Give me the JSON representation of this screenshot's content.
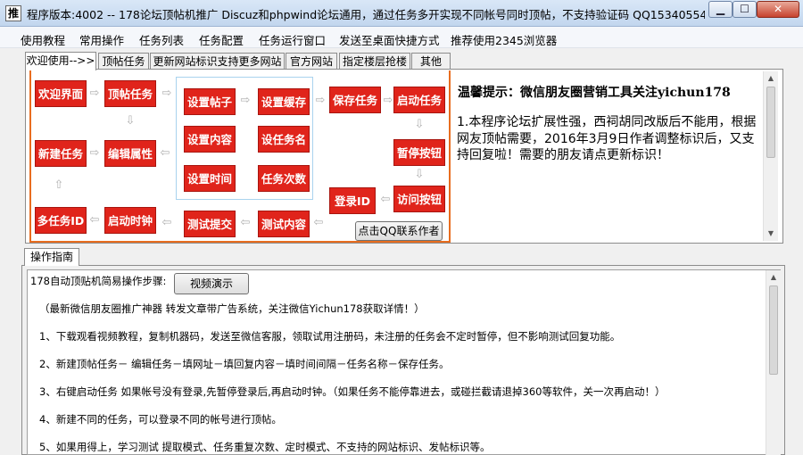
{
  "window": {
    "title": "程序版本:4002 -- 178论坛顶帖机推广 Discuz和phpwind论坛通用，通过任务多开实现不同帐号同时顶帖，不支持验证码   QQ15340554 官网...",
    "app_icon": "推",
    "min_glyph": "▁",
    "max_glyph": "☐",
    "close_glyph": "✕"
  },
  "menu": [
    "使用教程",
    "常用操作",
    "任务列表",
    "任务配置",
    "任务运行窗口",
    "发送至桌面快捷方式",
    "推荐使用2345浏览器"
  ],
  "tabs": [
    "欢迎使用-->>",
    "顶帖任务",
    "更新网站标识支持更多网站",
    "官方网站",
    "指定楼层抢楼",
    "其他"
  ],
  "flow": {
    "boxes": [
      "欢迎界面",
      "顶帖任务",
      "设置帖子",
      "设置缓存",
      "保存任务",
      "启动任务",
      "设置内容",
      "设任务名",
      "设置时间",
      "任务次数",
      "新建任务",
      "编辑属性",
      "暂停按钮",
      "登录ID",
      "访问按钮",
      "多任务ID",
      "启动时钟",
      "测试提交",
      "测试内容"
    ],
    "qq_button": "点击QQ联系作者"
  },
  "notice": {
    "title": "温馨提示：微信朋友圈营销工具关注yichun178",
    "text": "1.本程序论坛扩展性强，西祠胡同改版后不能用，根据网友顶帖需要，2016年3月9日作者调整标识后，又支持回复啦！需要的朋友请点更新标识！"
  },
  "guide": {
    "tab": "操作指南",
    "heading": "178自动顶贴机简易操作步骤:",
    "video_button": "视频演示",
    "lines": [
      "（最新微信朋友圈推广神器 转发文章带广告系统，关注微信Yichun178获取详情！）",
      "1、下载观看视频教程，复制机器码，发送至微信客服，领取试用注册码，未注册的任务会不定时暂停，但不影响测试回复功能。",
      "2、新建顶帖任务－ 编辑任务－填网址－填回复内容－填时间间隔－任务名称－保存任务。",
      "3、右键启动任务 如果帐号没有登录,先暂停登录后,再启动时钟。（如果任务不能停靠进去，或碰拦截请退掉360等软件，关一次再启动！）",
      "4、新建不同的任务，可以登录不同的帐号进行顶帖。",
      "5、如果用得上，学习测试 提取模式、任务重复次数、定时模式、不支持的网站标识、发帖标识等。"
    ]
  },
  "icons": {
    "arrow_right": "⇨",
    "arrow_left": "⇦",
    "arrow_down": "⇩",
    "arrow_up": "⇧",
    "scroll_up": "▲",
    "scroll_down": "▼"
  }
}
